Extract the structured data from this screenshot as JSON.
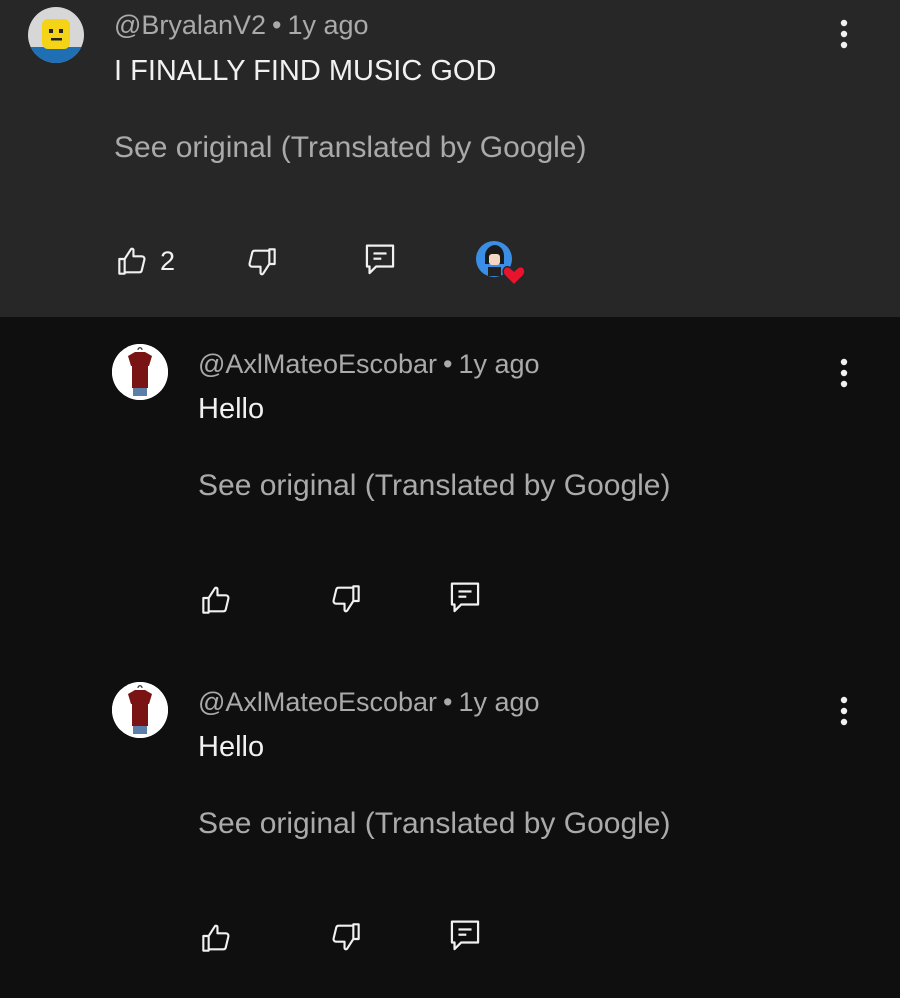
{
  "comments": [
    {
      "handle": "@BryalanV2",
      "time": "1y ago",
      "text": "I FINALLY FIND MUSIC GOD",
      "see_original": "See original (Translated by Google)",
      "likes": "2",
      "hearted_by_creator": true
    },
    {
      "handle": "@AxlMateoEscobar",
      "time": "1y ago",
      "text": "Hello",
      "see_original": "See original (Translated by Google)",
      "likes": ""
    },
    {
      "handle": "@AxlMateoEscobar",
      "time": "1y ago",
      "text": "Hello",
      "see_original": "See original (Translated by Google)",
      "likes": ""
    }
  ],
  "colors": {
    "highlight_bg": "#272727",
    "page_bg": "#0f0f0f",
    "heart": "#e8132d"
  }
}
